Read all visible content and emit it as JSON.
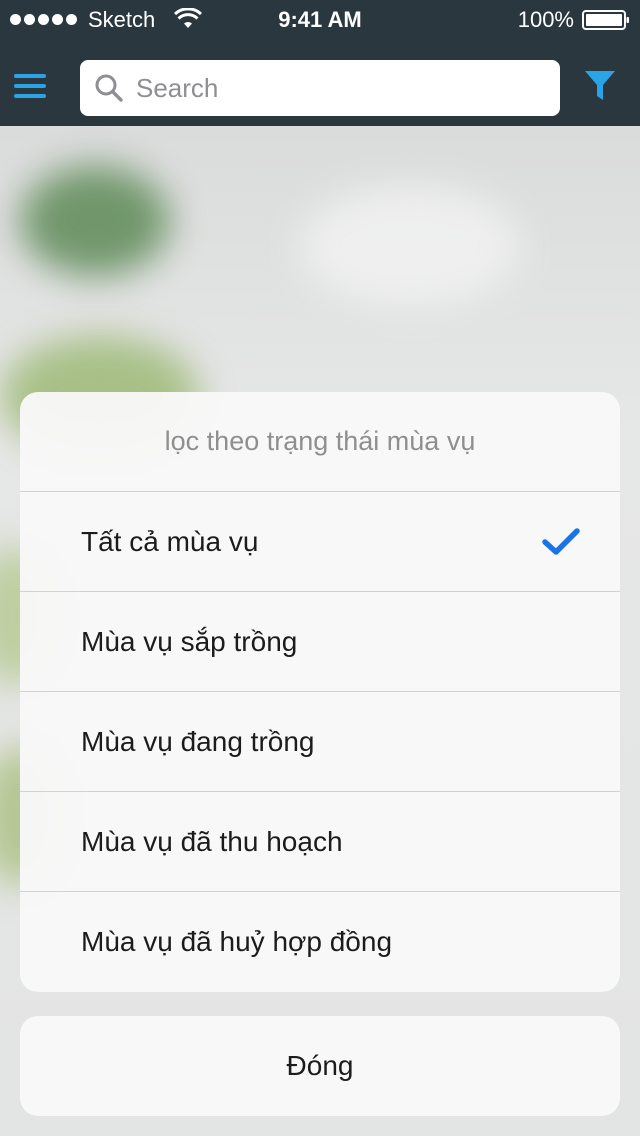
{
  "status_bar": {
    "carrier": "Sketch",
    "time": "9:41 AM",
    "battery": "100%"
  },
  "nav": {
    "menu_icon": "hamburger-menu-icon",
    "search_placeholder": "Search",
    "filter_icon": "funnel-filter-icon"
  },
  "colors": {
    "accent": "#2aa3e7",
    "check": "#1a74e8",
    "header_bg": "#2b373f"
  },
  "action_sheet": {
    "title": "lọc theo trạng thái mùa vụ",
    "options": [
      {
        "label": "Tất cả mùa vụ",
        "selected": true
      },
      {
        "label": "Mùa vụ sắp trồng",
        "selected": false
      },
      {
        "label": "Mùa vụ đang trồng",
        "selected": false
      },
      {
        "label": "Mùa vụ đã thu hoạch",
        "selected": false
      },
      {
        "label": "Mùa vụ đã huỷ hợp đồng",
        "selected": false
      }
    ],
    "close_label": "Đóng"
  }
}
